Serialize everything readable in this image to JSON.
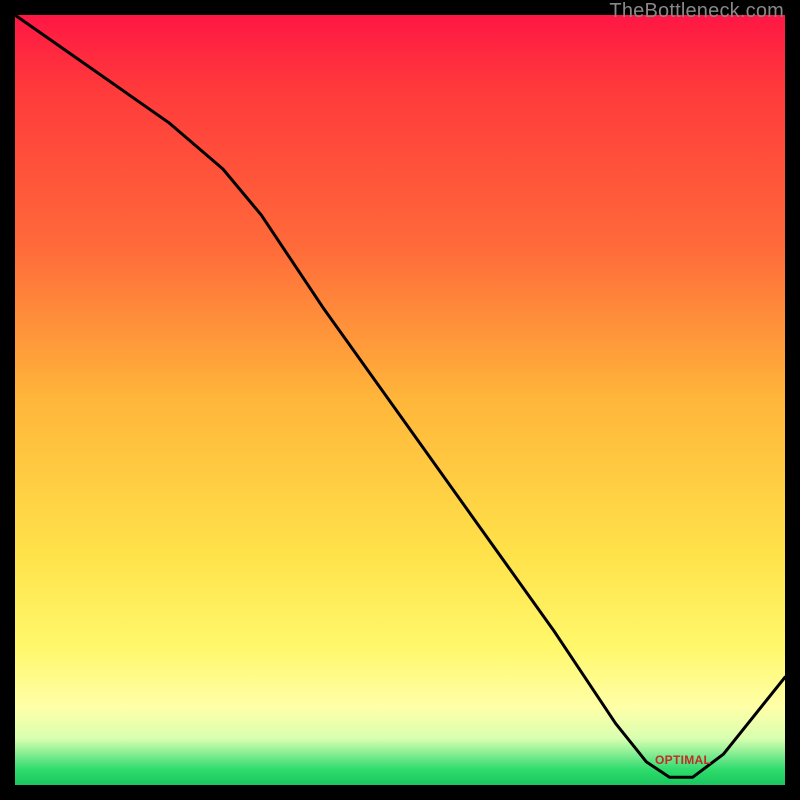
{
  "watermark": "TheBottleneck.com",
  "chart_data": {
    "type": "line",
    "title": "",
    "xlabel": "",
    "ylabel": "",
    "xlim": [
      0,
      100
    ],
    "ylim": [
      0,
      100
    ],
    "grid": false,
    "legend": false,
    "background": "red-yellow-green vertical gradient",
    "series": [
      {
        "name": "curve",
        "x": [
          0,
          10,
          20,
          27,
          32,
          40,
          50,
          60,
          70,
          78,
          82,
          85,
          88,
          92,
          100
        ],
        "y": [
          100,
          93,
          86,
          80,
          74,
          62,
          48,
          34,
          20,
          8,
          3,
          1,
          1,
          4,
          14
        ]
      }
    ],
    "highlight_band_y": [
      0,
      3
    ],
    "annotations": [
      {
        "text": "OPTIMAL",
        "x": 85,
        "y": 1,
        "color": "#c82828"
      }
    ]
  },
  "colors": {
    "line": "#000000",
    "annotation": "#c82828",
    "watermark": "#888888"
  }
}
